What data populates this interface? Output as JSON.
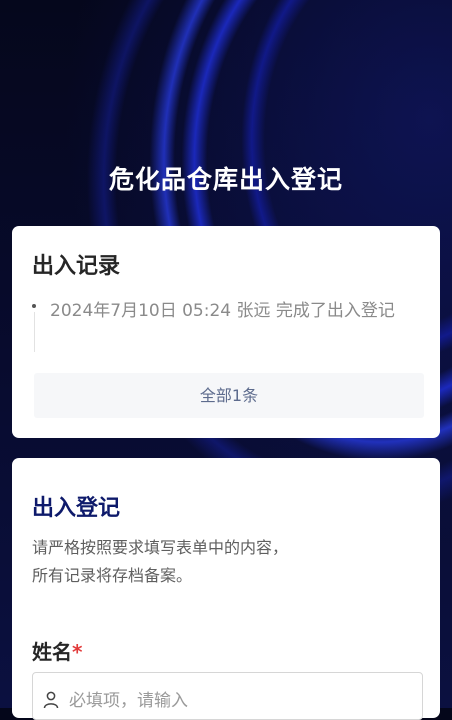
{
  "page": {
    "title": "危化品仓库出入登记"
  },
  "records_card": {
    "heading": "出入记录",
    "entries": [
      {
        "text": "2024年7月10日 05:24  张远  完成了出入登记"
      }
    ],
    "all_button": "全部1条"
  },
  "register_card": {
    "heading": "出入登记",
    "description_line1": "请严格按照要求填写表单中的内容，",
    "description_line2": "所有记录将存档备案。",
    "name_field": {
      "label": "姓名",
      "required_mark": "*",
      "placeholder": "必填项，请输入",
      "value": ""
    }
  },
  "colors": {
    "heading_accent": "#0e1a6b",
    "required": "#e23b3b",
    "link_text": "#5d6b8d"
  },
  "icons": {
    "name_field_icon": "user-icon"
  }
}
